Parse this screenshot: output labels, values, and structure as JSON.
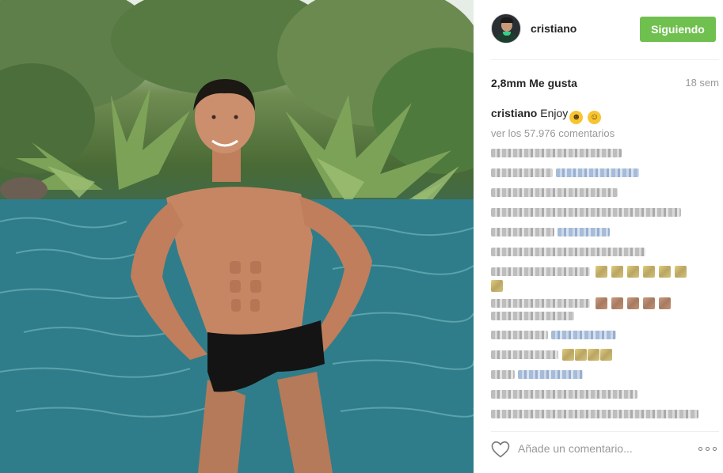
{
  "post": {
    "username": "cristiano",
    "follow_label": "Siguiendo",
    "likes": "2,8mm Me gusta",
    "time_ago": "18 sem",
    "caption_user": "cristiano",
    "caption_text": "Enjoy",
    "caption_emojis": [
      "grinning-sweat-emoji",
      "tongue-out-emoji"
    ],
    "view_comments": "ver los 57.976 comentarios",
    "comment_placeholder": "Añade un comentario...",
    "photo_alt": "Man standing in a pool surrounded by palm plants",
    "colors": {
      "follow_bg": "#70c050",
      "link": "#003569",
      "muted": "#999999",
      "text": "#262626"
    }
  },
  "comments": [
    {
      "blurred": true,
      "kind": "text"
    },
    {
      "blurred": true,
      "kind": "text+mention"
    },
    {
      "blurred": true,
      "kind": "text"
    },
    {
      "blurred": true,
      "kind": "text"
    },
    {
      "blurred": true,
      "kind": "text+mention"
    },
    {
      "blurred": true,
      "kind": "text"
    },
    {
      "blurred": true,
      "kind": "text+emojis"
    },
    {
      "blurred": true,
      "kind": "text+emojis"
    },
    {
      "blurred": true,
      "kind": "text+mention"
    },
    {
      "blurred": true,
      "kind": "text+emojis"
    },
    {
      "blurred": true,
      "kind": "text+mention"
    },
    {
      "blurred": true,
      "kind": "text"
    },
    {
      "blurred": true,
      "kind": "text"
    }
  ],
  "icons": {
    "heart": "heart-outline-icon",
    "more": "more-options-icon"
  }
}
